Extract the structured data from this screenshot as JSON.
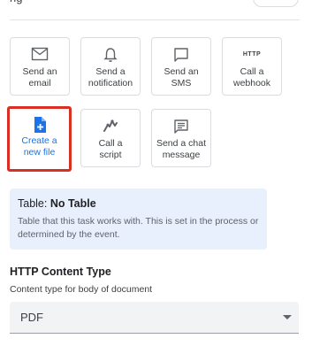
{
  "top": {
    "fragment_text": "ng"
  },
  "actions": [
    {
      "line1": "Send an",
      "line2": "email",
      "icon": "email-icon"
    },
    {
      "line1": "Send a",
      "line2": "notification",
      "icon": "bell-icon"
    },
    {
      "line1": "Send an",
      "line2": "SMS",
      "icon": "chat-bubble-icon"
    },
    {
      "line1": "Call a",
      "line2": "webhook",
      "icon": "http-icon",
      "icon_text": "HTTP"
    },
    {
      "line1": "Create a",
      "line2": "new file",
      "icon": "new-file-icon",
      "selected": true
    },
    {
      "line1": "Call a",
      "line2": "script",
      "icon": "script-icon"
    },
    {
      "line1": "Send a chat",
      "line2": "message",
      "icon": "chat-message-icon"
    }
  ],
  "table_info": {
    "label": "Table:",
    "value": "No Table",
    "description": "Table that this task works with. This is set in the process or determined by the event."
  },
  "content_type": {
    "title": "HTTP Content Type",
    "description": "Content type for body of document",
    "selected": "PDF"
  },
  "colors": {
    "accent": "#1a73e8",
    "selection_outline": "#d93025",
    "info_background": "#e8f0fe"
  }
}
